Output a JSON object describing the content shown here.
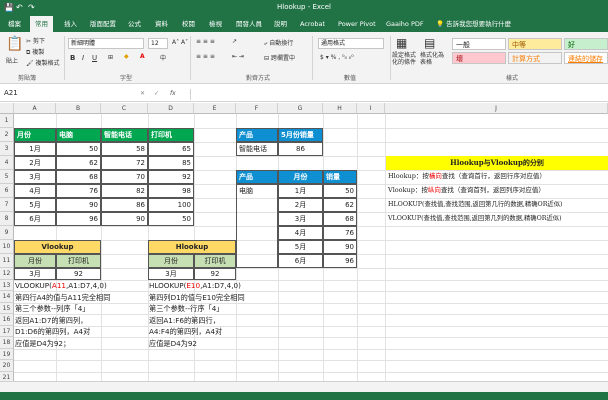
{
  "title": "Hlookup - Excel",
  "tabs": [
    "檔案",
    "常用",
    "插入",
    "版面配置",
    "公式",
    "資料",
    "校閱",
    "檢視",
    "開發人員",
    "說明",
    "Acrobat",
    "Power Pivot",
    "Gaaiho PDF"
  ],
  "tell_me": "告訴我您想要執行什麼",
  "ribbon": {
    "clipboard": {
      "cut": "剪下",
      "copy": "複製",
      "format_painter": "複製格式",
      "paste": "貼上",
      "label": "剪貼簿"
    },
    "font": {
      "name": "新細明體",
      "size": "12",
      "label": "字型"
    },
    "alignment": {
      "wrap": "自動換行",
      "merge": "跨欄置中",
      "label": "對齊方式"
    },
    "number": {
      "format": "通用格式",
      "label": "數值"
    },
    "conditional": "設定格式化的條件",
    "format_table": "格式化為表格",
    "styles": {
      "normal": "一般",
      "medium": "中等",
      "good": "好",
      "bad": "壞",
      "calc": "計算方式",
      "linked": "連結的儲存",
      "label": "樣式"
    }
  },
  "formula_bar": {
    "cell_ref": "A21",
    "fx": "fx"
  },
  "columns": [
    "A",
    "B",
    "C",
    "D",
    "E",
    "F",
    "G",
    "H",
    "I",
    "J"
  ],
  "rows": [
    "1",
    "2",
    "3",
    "4",
    "5",
    "6",
    "7",
    "8",
    "9",
    "10",
    "11",
    "12",
    "13",
    "14",
    "15",
    "16",
    "17",
    "18",
    "19",
    "20",
    "21"
  ],
  "table1": {
    "headers": [
      "月份",
      "电脑",
      "智能电话",
      "打印机"
    ],
    "rows": [
      [
        "1月",
        "50",
        "58",
        "65"
      ],
      [
        "2月",
        "62",
        "72",
        "85"
      ],
      [
        "3月",
        "68",
        "70",
        "92"
      ],
      [
        "4月",
        "76",
        "82",
        "98"
      ],
      [
        "5月",
        "90",
        "86",
        "100"
      ],
      [
        "6月",
        "96",
        "90",
        "50"
      ]
    ]
  },
  "table2": {
    "headers": [
      "产品",
      "5月份销量"
    ],
    "row": [
      "智能电话",
      "86"
    ]
  },
  "table3": {
    "headers": [
      "产品",
      "月份",
      "销量"
    ],
    "product": "电脑",
    "months": [
      "1月",
      "2月",
      "3月",
      "4月",
      "5月",
      "6月"
    ],
    "values": [
      "50",
      "62",
      "68",
      "76",
      "90",
      "96"
    ]
  },
  "vlookup_box": {
    "title": "Vlookup",
    "h1": "月份",
    "h2": "打印机",
    "v1": "3月",
    "v2": "92"
  },
  "hlookup_box": {
    "title": "Hlookup",
    "h1": "月份",
    "h2": "打印机",
    "v1": "3月",
    "v2": "92"
  },
  "vnote": {
    "pre": "VLOOKUP(",
    "red": "A11",
    "post": ",A1:D7,4,0)",
    "lines": [
      "第四行A4的值与A11完全相同",
      "第三个参数--列序「4」",
      "返回A1:D7的第四列，",
      "D1:D6的第四列，A4对",
      "应值是D4为92；"
    ]
  },
  "hnote": {
    "pre": "HLOOKUP(",
    "red": "E10",
    "post": ",A1:D7,4,0)",
    "lines": [
      "第四列D1的值与E10完全相同",
      "第三个参数--行序「4」",
      "返回A1:F6的第四行，",
      "A4:F4的第四列，A4对",
      "应值是D4为92"
    ]
  },
  "compare": {
    "title": "Hlookup与Vlookup的分别",
    "lines": [
      {
        "pre": "Hlookup：按",
        "red": "橫向",
        "post": "查找（查询首行，返回行序对应值）"
      },
      {
        "pre": "Vlookup：按",
        "red": "纵向",
        "post": "查找（查询首列，返回列序对应值）"
      },
      {
        "pre": "HLOOKUP(查找值,查找范围,返回第几行的数据,精确OR近似)",
        "red": "",
        "post": ""
      },
      {
        "pre": "VLOOKUP(查找值,查找范围,返回第几列的数据,精确OR近似)",
        "red": "",
        "post": ""
      }
    ]
  },
  "colors": {
    "excel_green": "#217346",
    "header_green": "#00a650",
    "header_blue": "#0d8fd1",
    "box_yellow": "#ffd966",
    "box_green": "#c6e0b4",
    "title_yellow": "#ffff00"
  }
}
